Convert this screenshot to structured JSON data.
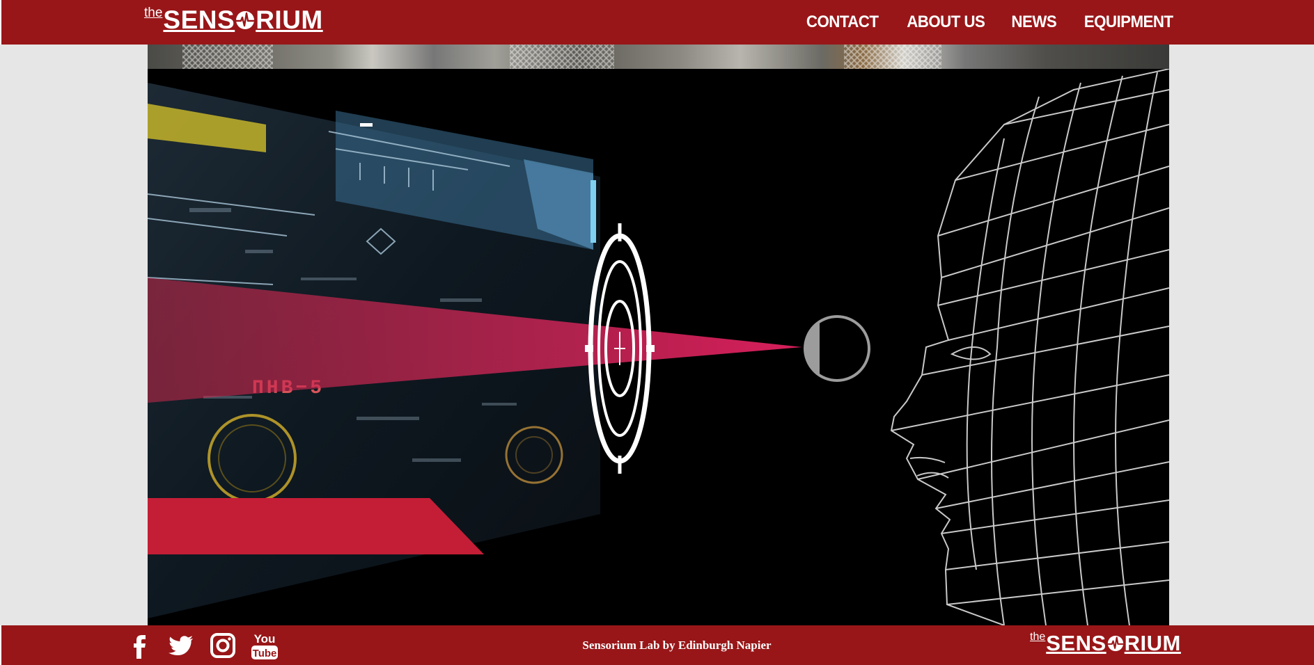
{
  "brand": {
    "prefix": "the",
    "name_left": "SENS",
    "name_right": "RIUM"
  },
  "nav": {
    "items": [
      {
        "label": "CONTACT"
      },
      {
        "label": "ABOUT US"
      },
      {
        "label": "NEWS"
      },
      {
        "label": "EQUIPMENT"
      }
    ]
  },
  "hero": {
    "hud_text": "ΠΗΒ−5",
    "icons": [
      "crosshair-target-icon",
      "eye-icon",
      "wireframe-face"
    ]
  },
  "footer": {
    "social": [
      "facebook-icon",
      "twitter-icon",
      "instagram-icon",
      "youtube-icon"
    ],
    "youtube_top": "You",
    "youtube_bottom": "Tube",
    "credit": "Sensorium Lab by Edinburgh Napier"
  },
  "colors": {
    "header_red": "#981618",
    "accent_pink": "#c8284a",
    "bar_red": "#c41e36",
    "page_grey": "#e6e6e6"
  }
}
